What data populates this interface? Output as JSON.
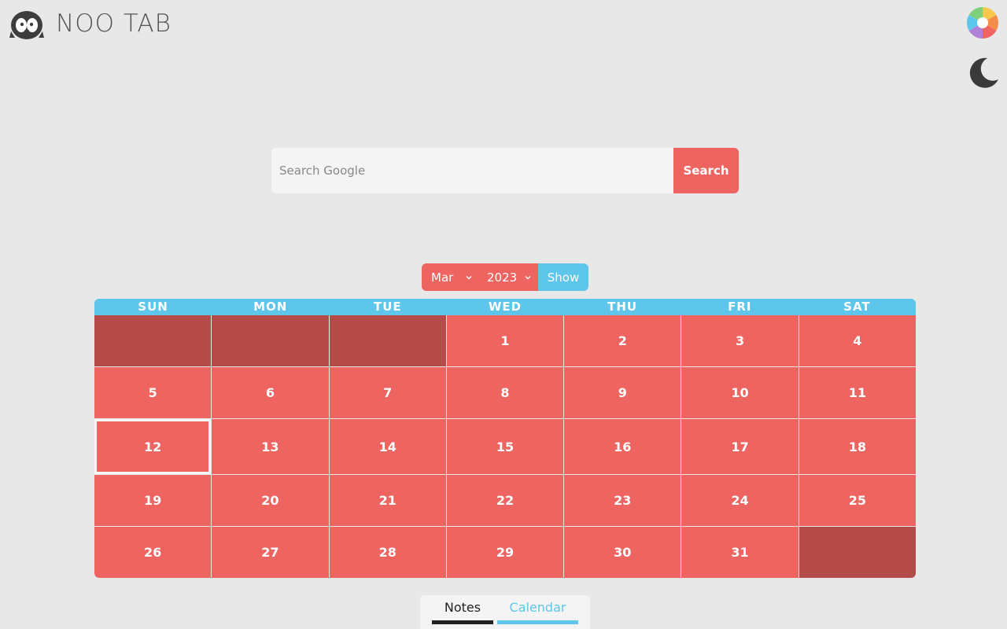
{
  "header": {
    "app_title": "NOO TAB",
    "logo_icon": "penguin-icon",
    "theme_icon": "color-wheel-icon",
    "dark_mode_icon": "moon-icon"
  },
  "search": {
    "placeholder": "Search Google",
    "value": "",
    "button_label": "Search"
  },
  "picker": {
    "month": "Mar",
    "year": "2023",
    "show_label": "Show"
  },
  "calendar": {
    "weekdays": [
      "SUN",
      "MON",
      "TUE",
      "WED",
      "THU",
      "FRI",
      "SAT"
    ],
    "days": [
      "",
      "",
      "",
      "1",
      "2",
      "3",
      "4",
      "5",
      "6",
      "7",
      "8",
      "9",
      "10",
      "11",
      "12",
      "13",
      "14",
      "15",
      "16",
      "17",
      "18",
      "19",
      "20",
      "21",
      "22",
      "23",
      "24",
      "25",
      "26",
      "27",
      "28",
      "29",
      "30",
      "31",
      ""
    ],
    "today": "12"
  },
  "tabs": {
    "notes_label": "Notes",
    "calendar_label": "Calendar",
    "active": "Calendar"
  },
  "colors": {
    "background": "#e8e8e8",
    "accent_red": "#ee6461",
    "empty_day": "#b44b49",
    "accent_blue": "#5dc6ea"
  }
}
